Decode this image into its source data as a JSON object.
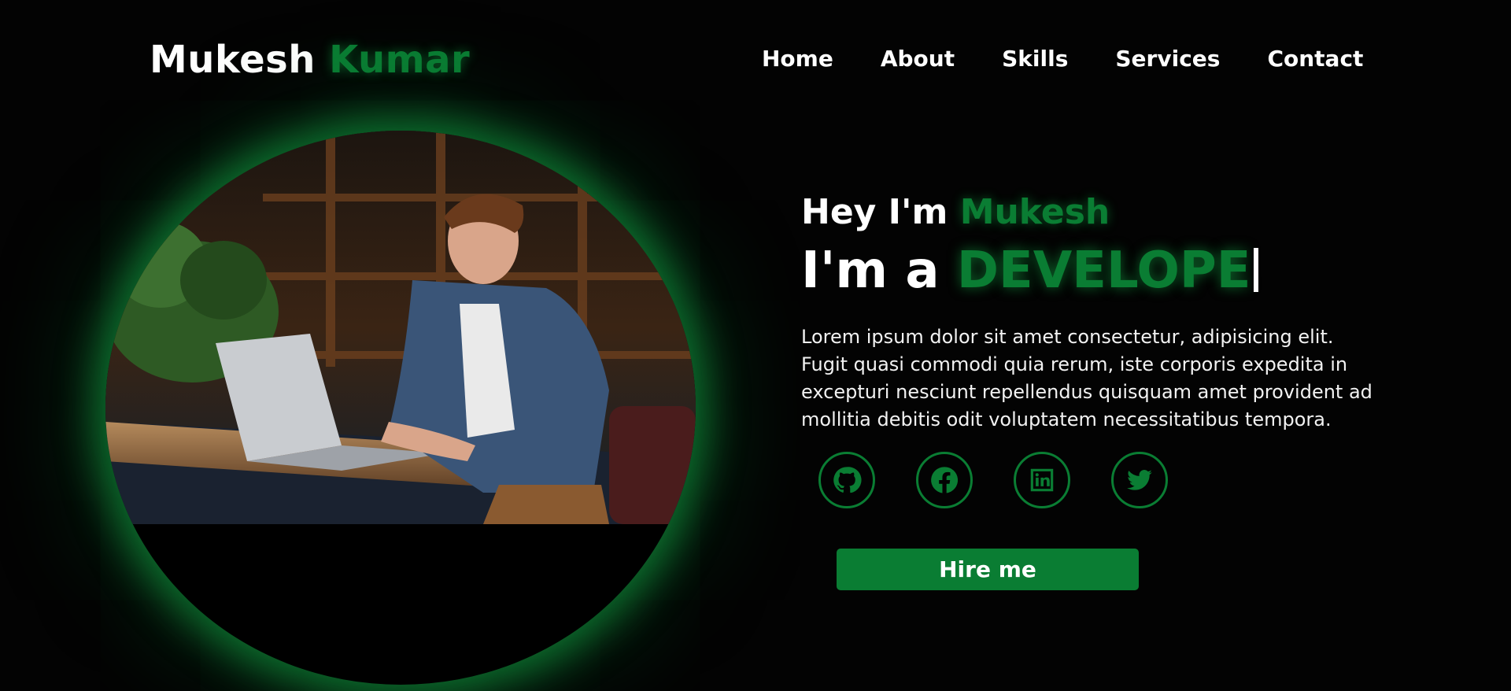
{
  "header": {
    "logo_first": "Mukesh",
    "logo_second": "Kumar",
    "nav": [
      "Home",
      "About",
      "Skills",
      "Services",
      "Contact"
    ]
  },
  "hero": {
    "greeting": "Hey I'm",
    "name": "Mukesh",
    "role_prefix": "I'm a",
    "role_typed": "DEVELOPE",
    "description": "Lorem ipsum dolor sit amet consectetur, adipisicing elit. Fugit quasi commodi quia rerum, iste corporis expedita in excepturi nesciunt repellendus quisquam amet provident ad mollitia debitis odit voluptatem necessitatibus tempora.",
    "hire_label": "Hire me",
    "socials": [
      {
        "icon": "github-icon"
      },
      {
        "icon": "facebook-icon"
      },
      {
        "icon": "linkedin-icon"
      },
      {
        "icon": "twitter-icon"
      }
    ]
  },
  "colors": {
    "accent": "#0a7d33",
    "background": "#030303",
    "text": "#ffffff"
  }
}
